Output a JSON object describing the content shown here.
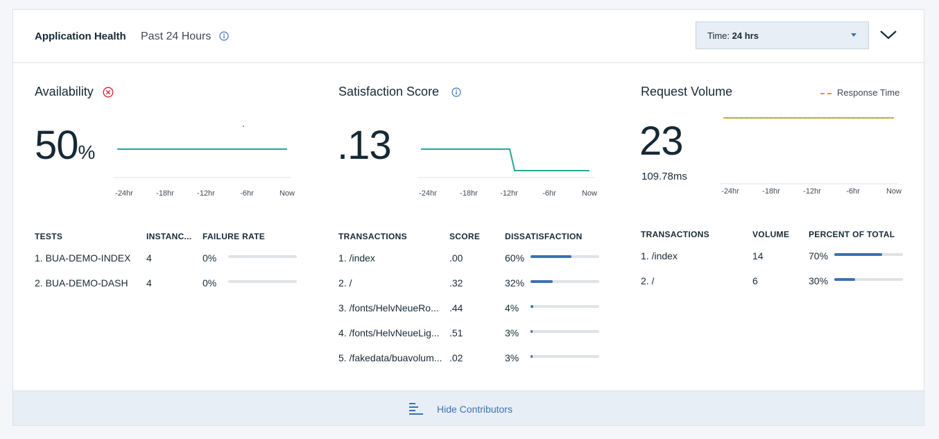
{
  "header": {
    "title": "Application Health",
    "subtitle": "Past 24 Hours",
    "time_label": "Time: ",
    "time_value": "24 hrs"
  },
  "availability": {
    "title": "Availability",
    "value": "50",
    "unit": "%",
    "chart_x_labels": [
      "-24hr",
      "-18hr",
      "-12hr",
      "-6hr",
      "Now"
    ],
    "columns": [
      "TESTS",
      "INSTANC...",
      "FAILURE RATE"
    ],
    "rows": [
      {
        "name": "1. BUA-DEMO-INDEX",
        "instances": "4",
        "failure_rate": "0%",
        "pct": 0
      },
      {
        "name": "2. BUA-DEMO-DASH",
        "instances": "4",
        "failure_rate": "0%",
        "pct": 0
      }
    ]
  },
  "satisfaction": {
    "title": "Satisfaction Score",
    "value": ".13",
    "chart_x_labels": [
      "-24hr",
      "-18hr",
      "-12hr",
      "-6hr",
      "Now"
    ],
    "columns": [
      "TRANSACTIONS",
      "SCORE",
      "DISSATISFACTION"
    ],
    "rows": [
      {
        "name": "1. /index",
        "score": ".00",
        "dissatisfaction": "60%",
        "pct": 60
      },
      {
        "name": "2. /",
        "score": ".32",
        "dissatisfaction": "32%",
        "pct": 32
      },
      {
        "name": "3. /fonts/HelvNeueRo...",
        "score": ".44",
        "dissatisfaction": "4%",
        "pct": 4
      },
      {
        "name": "4. /fonts/HelvNeueLig...",
        "score": ".51",
        "dissatisfaction": "3%",
        "pct": 3
      },
      {
        "name": "5. /fakedata/buavolum...",
        "score": ".02",
        "dissatisfaction": "3%",
        "pct": 3
      }
    ]
  },
  "request_volume": {
    "title": "Request Volume",
    "value": "23",
    "response_time": "109.78ms",
    "legend_label": "Response Time",
    "chart_x_labels": [
      "-24hr",
      "-18hr",
      "-12hr",
      "-6hr",
      "Now"
    ],
    "columns": [
      "TRANSACTIONS",
      "VOLUME",
      "PERCENT OF TOTAL"
    ],
    "rows": [
      {
        "name": "1. /index",
        "volume": "14",
        "percent": "70%",
        "pct": 70
      },
      {
        "name": "2. /",
        "volume": "6",
        "percent": "30%",
        "pct": 30
      }
    ]
  },
  "footer": {
    "label": "Hide Contributors"
  },
  "colors": {
    "accent": "#3d70b2",
    "line": "#26a69a",
    "error": "#e0182d",
    "response_time": "#d9a017",
    "volume_line": "#5aa700"
  }
}
